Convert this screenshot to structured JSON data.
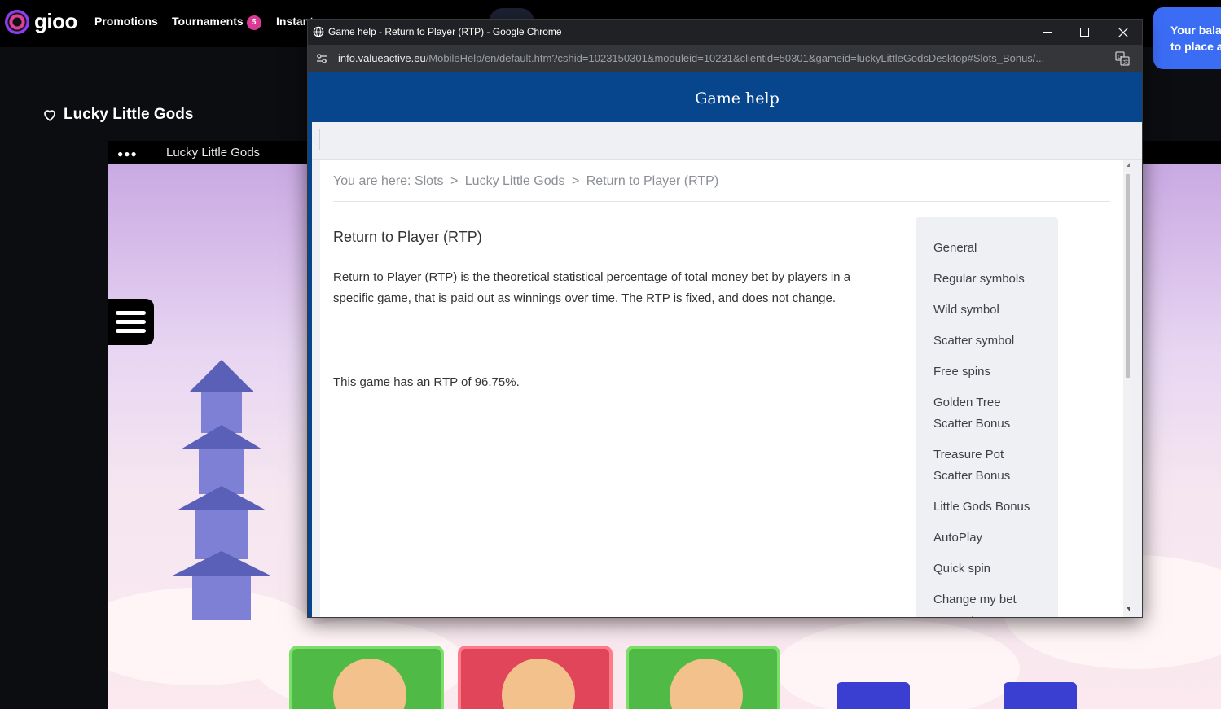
{
  "site": {
    "logo_text": "gioo",
    "nav": [
      {
        "label": "Promotions"
      },
      {
        "label": "Tournaments",
        "badge": "5"
      },
      {
        "label": "Instant"
      }
    ],
    "balance_line1": "Your bala",
    "balance_line2": "to place a",
    "game_title": "Lucky Little Gods",
    "game_bar_title": "Lucky Little Gods",
    "colors": {
      "nav_bg": "#000000",
      "badge": "#d93a94",
      "balance_button": "#3b6cf4"
    }
  },
  "window": {
    "title": "Game help - Return to Player (RTP) - Google Chrome",
    "url_host": "info.valueactive.eu",
    "url_path": "/MobileHelp/en/default.htm?cshid=1023150301&moduleid=10231&clientid=50301&gameid=luckyLittleGodsDesktop#Slots_Bonus/..."
  },
  "help": {
    "header_title": "Game help",
    "header_color": "#07468c",
    "breadcrumb": {
      "prefix": "You are here:",
      "items": [
        "Slots",
        "Lucky Little Gods",
        "Return to Player (RTP)"
      ],
      "separator": ">"
    },
    "heading": "Return to Player (RTP)",
    "paragraph": "Return to Player (RTP) is the theoretical statistical percentage of total money bet by players in a specific game, that is paid out as winnings over time. The RTP is fixed, and does not change.",
    "rtp_statement": "This game has an RTP of 96.75%.",
    "toc": [
      "General",
      "Regular symbols",
      "Wild symbol",
      "Scatter symbol",
      "Free spins",
      "Golden Tree Scatter Bonus",
      "Treasure Pot Scatter Bonus",
      "Little Gods Bonus",
      "AutoPlay",
      "Quick spin",
      "Change my bet amount"
    ]
  }
}
